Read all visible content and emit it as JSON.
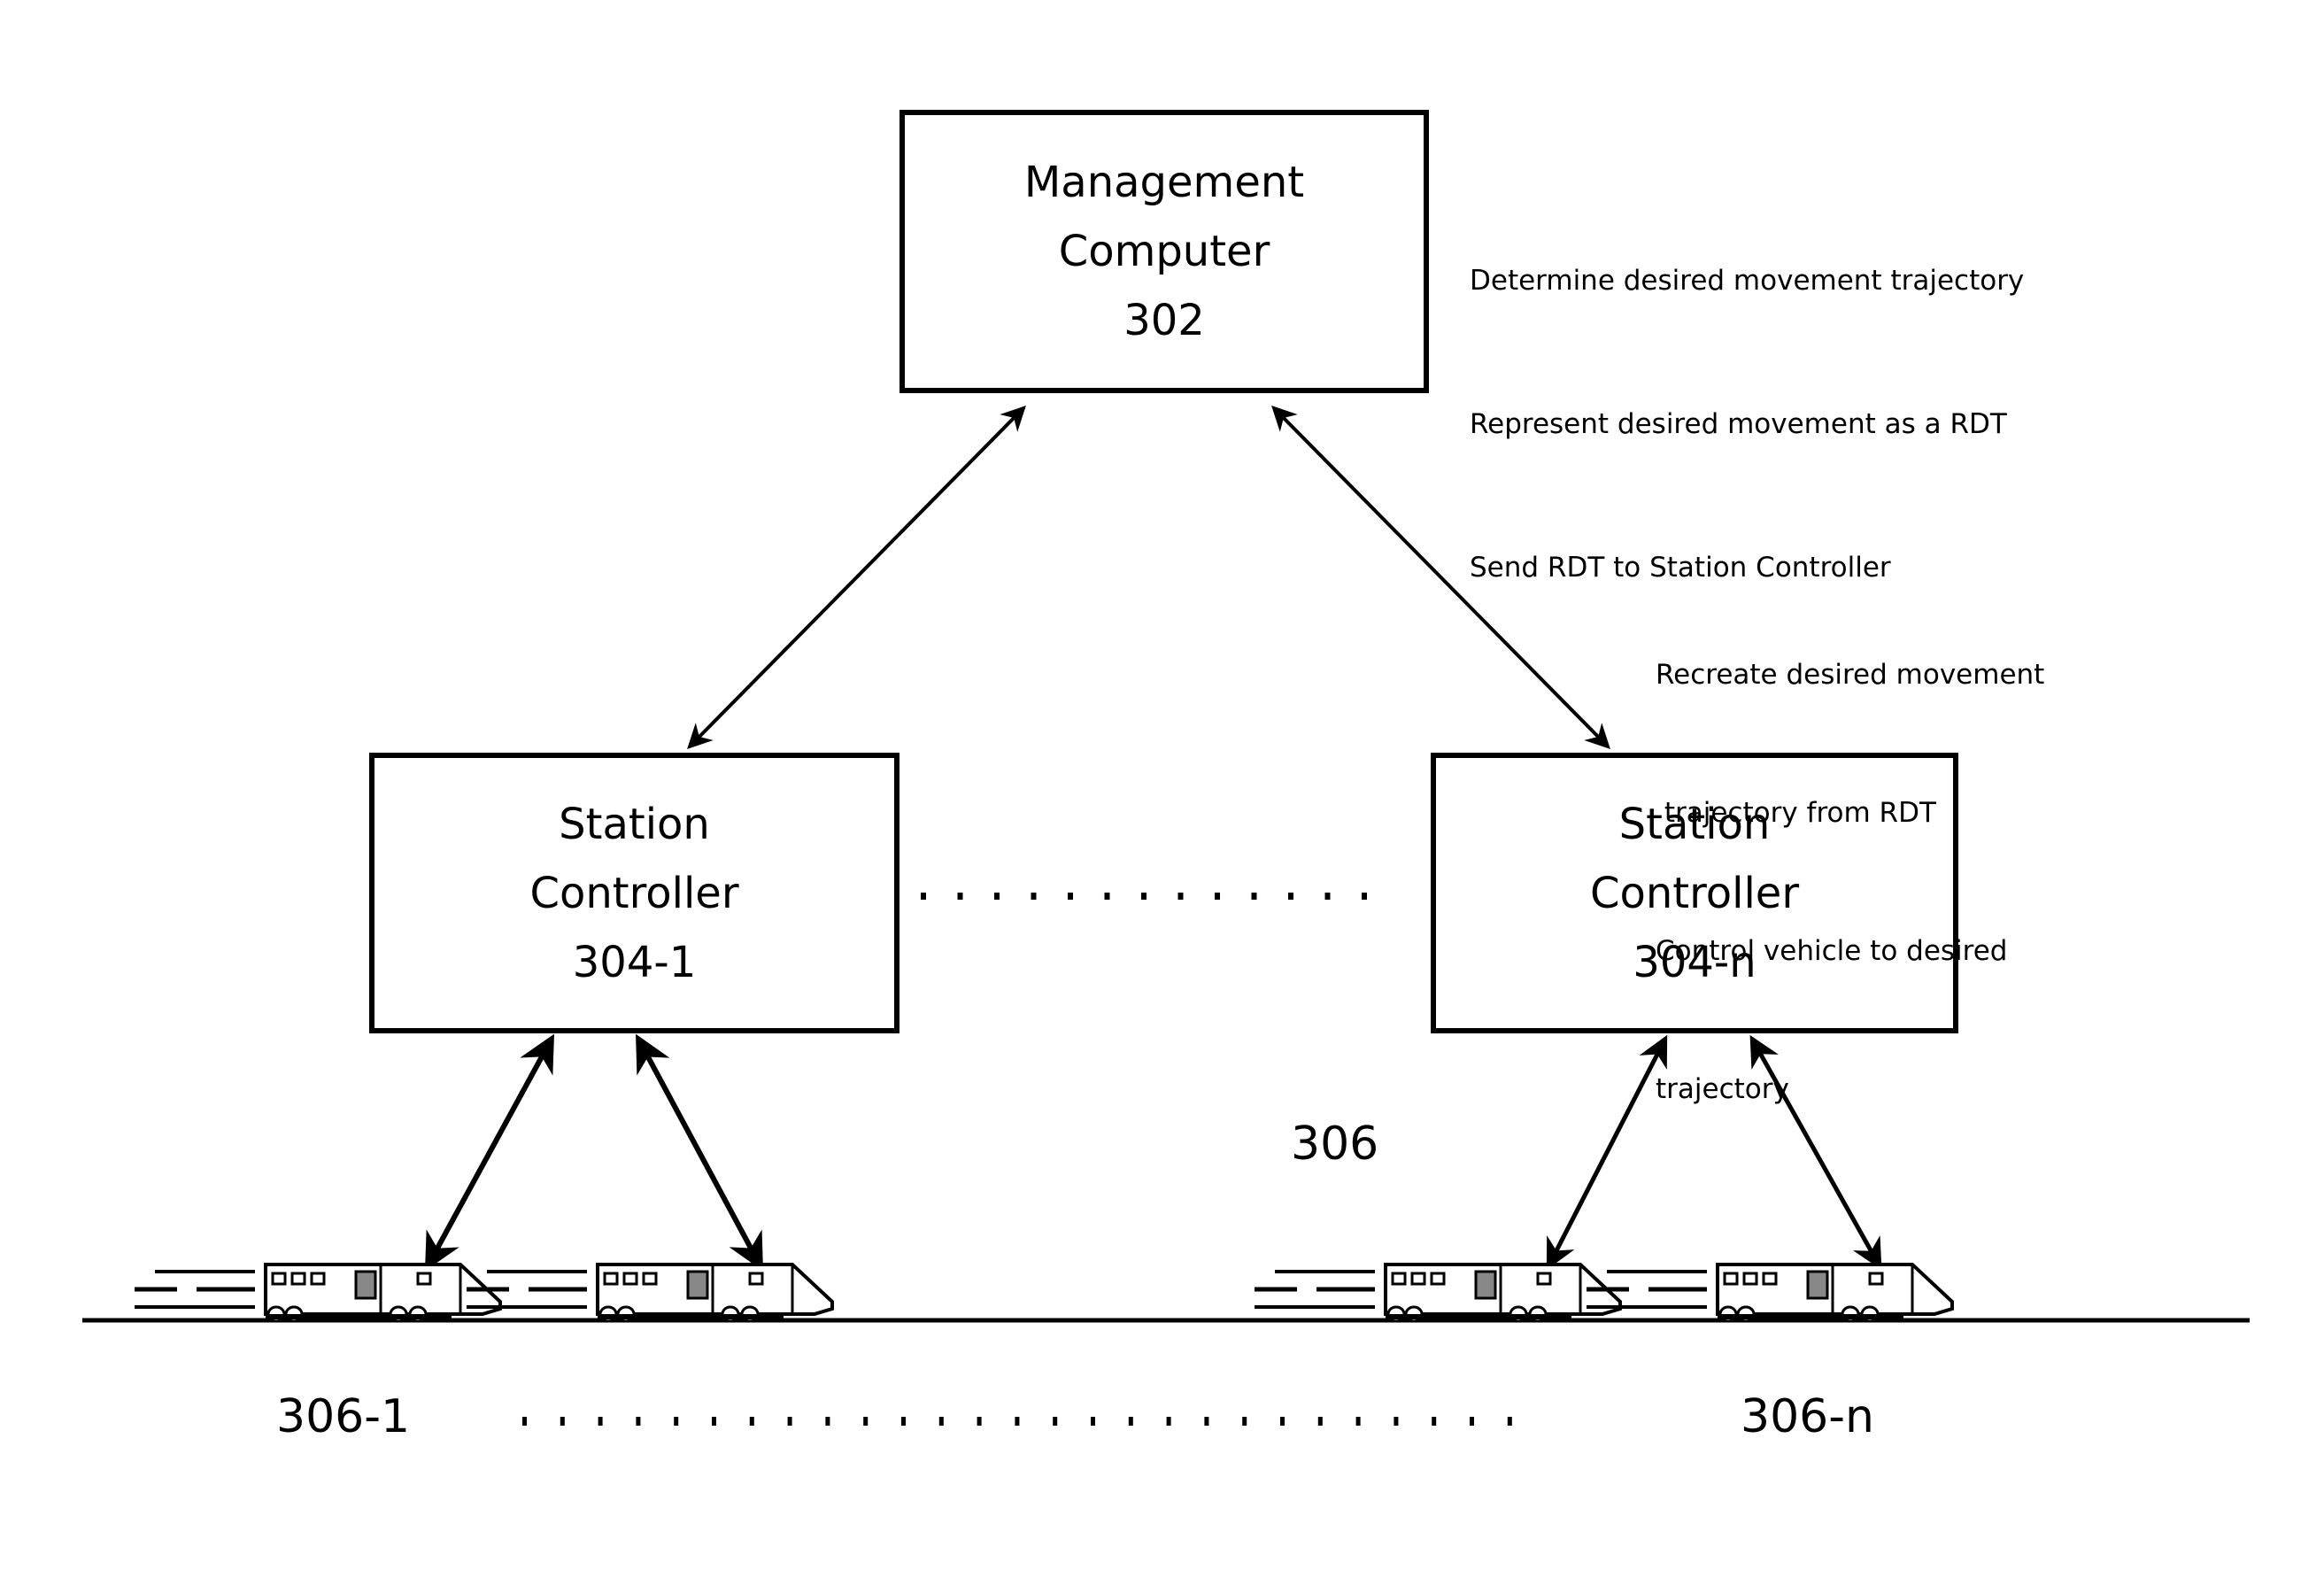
{
  "management": {
    "title_line1": "Management",
    "title_line2": "Computer",
    "ref": "302",
    "notes": [
      "Determine desired movement trajectory",
      "Represent desired movement as a RDT",
      "Send RDT to Station Controller"
    ]
  },
  "station_1": {
    "title_line1": "Station",
    "title_line2": "Controller",
    "ref": "304-1"
  },
  "station_n": {
    "title_line1": "Station",
    "title_line2": "Controller",
    "ref": "304-n",
    "notes": [
      "Recreate desired movement",
      " trajectory from RDT",
      "Control vehicle to desired",
      "trajectory"
    ]
  },
  "track": {
    "group_label": "306",
    "first_label": "306-1",
    "last_label": "306-n"
  },
  "vehicles": [
    {
      "name": "train-1a"
    },
    {
      "name": "train-1b"
    },
    {
      "name": "train-na"
    },
    {
      "name": "train-nb"
    }
  ]
}
